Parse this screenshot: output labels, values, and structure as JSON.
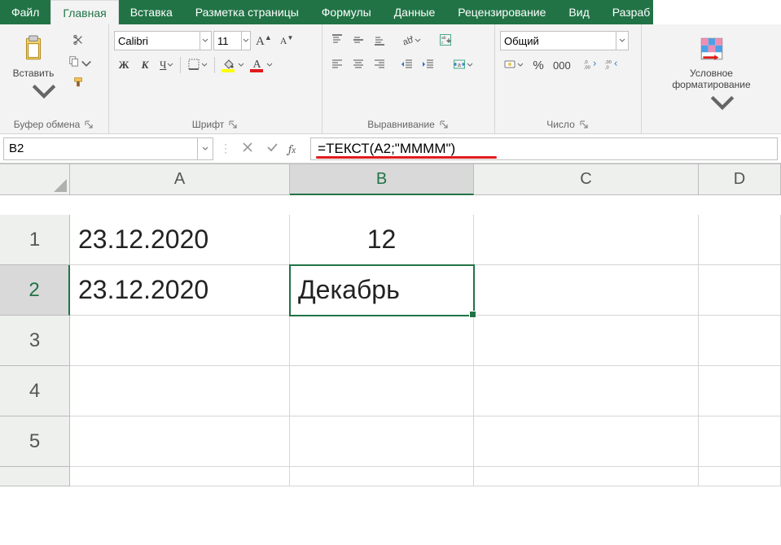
{
  "tabs": {
    "file": "Файл",
    "home": "Главная",
    "insert": "Вставка",
    "pageLayout": "Разметка страницы",
    "formulas": "Формулы",
    "data": "Данные",
    "review": "Рецензирование",
    "view": "Вид",
    "developer": "Разраб"
  },
  "ribbon": {
    "clipboard": {
      "paste": "Вставить",
      "groupLabel": "Буфер обмена"
    },
    "font": {
      "name": "Calibri",
      "size": "11",
      "groupLabel": "Шрифт"
    },
    "alignment": {
      "groupLabel": "Выравнивание"
    },
    "number": {
      "format": "Общий",
      "groupLabel": "Число"
    },
    "styles": {
      "condFormat": "Условное форматирование"
    }
  },
  "nameBox": "B2",
  "formula": "=ТЕКСТ(A2;\"ММММ\")",
  "grid": {
    "cols": [
      "A",
      "B",
      "C",
      "D"
    ],
    "rows": [
      "1",
      "2",
      "3",
      "4",
      "5"
    ],
    "cells": {
      "A1": "23.12.2020",
      "B1": "12",
      "A2": "23.12.2020",
      "B2": "Декабрь"
    },
    "selected": "B2"
  },
  "chart_data": null
}
